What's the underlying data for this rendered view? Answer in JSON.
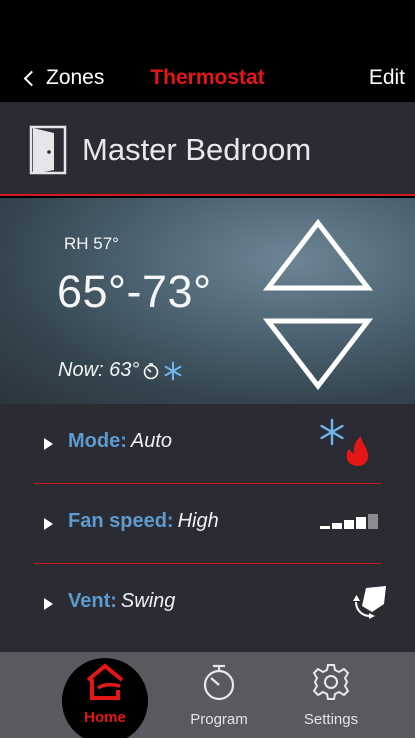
{
  "nav": {
    "back_label": "Zones",
    "title": "Thermostat",
    "edit_label": "Edit"
  },
  "room": {
    "name": "Master Bedroom"
  },
  "climate": {
    "humidity": "RH 57°",
    "range": "65°-73°",
    "now": "Now: 63°"
  },
  "settings": {
    "mode": {
      "key": "Mode:",
      "value": "Auto"
    },
    "fan": {
      "key": "Fan speed:",
      "value": "High"
    },
    "vent": {
      "key": "Vent:",
      "value": "Swing"
    }
  },
  "tabs": [
    {
      "label": "Home"
    },
    {
      "label": "Program"
    },
    {
      "label": "Settings"
    }
  ],
  "colors": {
    "accent": "#e41717",
    "label_blue": "#5d9bcf",
    "panel": "#2b2c33",
    "snow": "#6fb6f2"
  },
  "icons": [
    "door-icon",
    "chevron-left-icon",
    "timer-icon",
    "snowflake-icon",
    "flame-icon",
    "fan-speed-bars-icon",
    "vent-swing-icon",
    "home-icon",
    "stopwatch-icon",
    "gear-icon"
  ]
}
